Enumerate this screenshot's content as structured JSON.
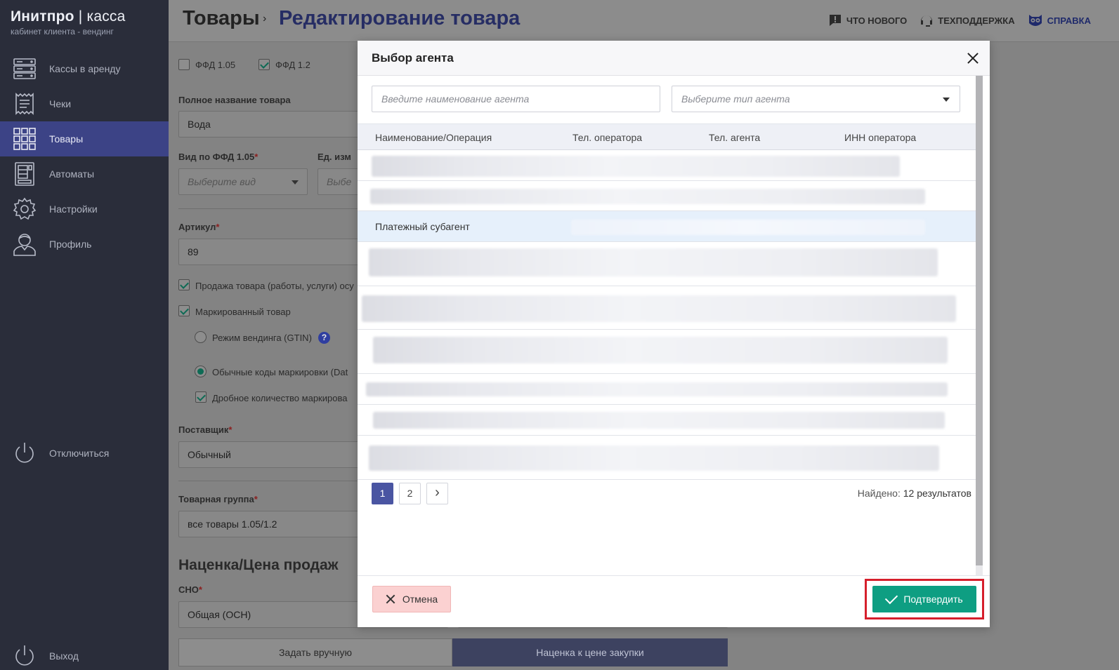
{
  "brand": {
    "name": "Инитпро",
    "separator": "|",
    "product": "касса",
    "subtitle": "кабинет клиента - вендинг"
  },
  "sidebar": {
    "items": [
      {
        "label": "Кассы в аренду",
        "icon": "server-icon"
      },
      {
        "label": "Чеки",
        "icon": "receipt-icon"
      },
      {
        "label": "Товары",
        "icon": "grid-icon",
        "active": true
      },
      {
        "label": "Автоматы",
        "icon": "vending-machine-icon"
      },
      {
        "label": "Настройки",
        "icon": "gear-icon"
      },
      {
        "label": "Профиль",
        "icon": "user-icon"
      }
    ],
    "disconnect": "Отключиться",
    "logout": "Выход"
  },
  "header": {
    "breadcrumb_root": "Товары",
    "breadcrumb_separator": "›",
    "breadcrumb_current": "Редактирование товара",
    "links": {
      "whats_new": "Что нового",
      "support": "Техподдержка",
      "help": "Справка"
    }
  },
  "form": {
    "ffd105": "ФФД 1.05",
    "ffd12": "ФФД 1.2",
    "full_name_label": "Полное название товара",
    "full_name_value": "Вода",
    "kind_label": "Вид по ФФД 1.05",
    "kind_placeholder": "Выберите вид",
    "unit_label": "Ед. изм",
    "unit_placeholder": "Выбе",
    "article_label": "Артикул",
    "article_value": "89",
    "sale_check": "Продажа товара (работы, услуги) осу",
    "marked_check": "Маркированный товар",
    "vending_mode": "Режим вендинга (GTIN)",
    "help_mark": "?",
    "regular_codes": "Обычные коды маркировки (Dat",
    "fractional": "Дробное количество маркирова",
    "supplier_label": "Поставщик",
    "supplier_value": "Обычный",
    "group_label": "Товарная группа",
    "group_value": "все товары 1.05/1.2",
    "markup_title": "Наценка/Цена продаж",
    "sno_label": "СНО",
    "sno_value": "Общая (ОСН)",
    "manual_tab": "Задать вручную",
    "markup_tab": "Наценка к цене закупки",
    "required_mark": "*"
  },
  "modal": {
    "title": "Выбор агента",
    "agent_name_placeholder": "Введите наименование агента",
    "agent_type_placeholder": "Выберите тип агента",
    "columns": [
      "Наименование/Операция",
      "Тел. оператора",
      "Тел. агента",
      "ИНН оператора"
    ],
    "selected_row_text": "Платежный субагент",
    "pages": [
      "1",
      "2"
    ],
    "next_icon": "›",
    "found_label": "Найдено:",
    "found_value": "12 результатов",
    "cancel": "Отмена",
    "confirm": "Подтвердить"
  },
  "colors": {
    "sidebar": "#2a2d3a",
    "active_nav": "#3c4386",
    "accent_green": "#0e9e82",
    "highlight_red": "#d61f2c",
    "pager_active": "#4a55a2"
  }
}
